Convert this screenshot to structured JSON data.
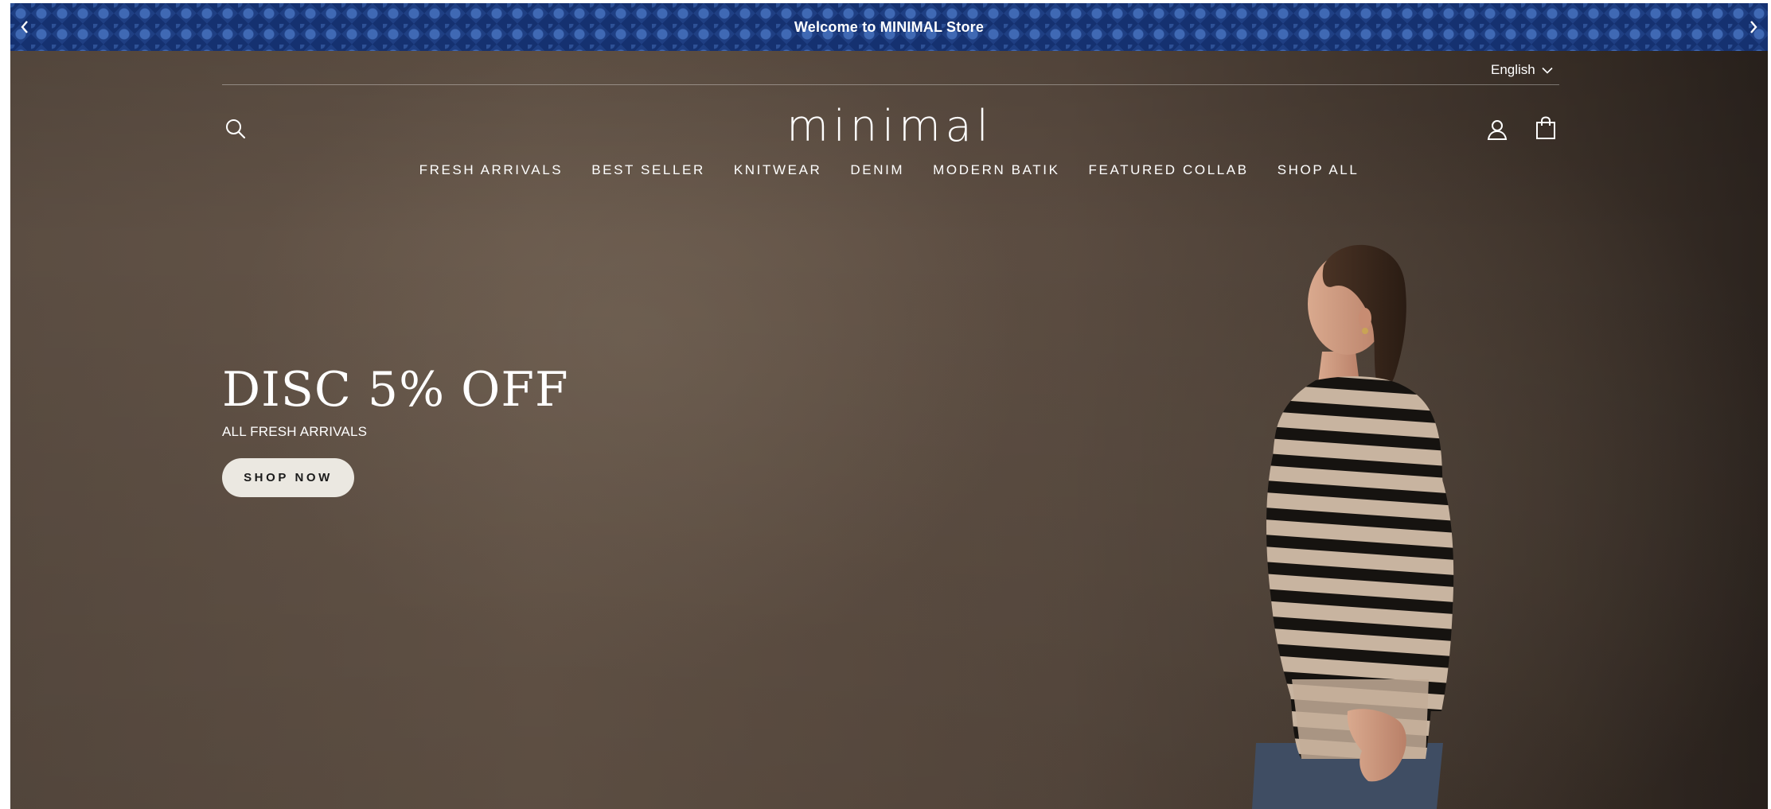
{
  "announcement": {
    "text": "Welcome to MINIMAL Store",
    "prev_icon": "chevron-left-icon",
    "next_icon": "chevron-right-icon"
  },
  "header": {
    "language": "English",
    "logo": "minimal",
    "icons": {
      "search": "search-icon",
      "account": "user-icon",
      "cart": "bag-icon",
      "language_dropdown": "chevron-down-icon"
    }
  },
  "nav": {
    "items": [
      "FRESH ARRIVALS",
      "BEST SELLER",
      "KNITWEAR",
      "DENIM",
      "MODERN BATIK",
      "FEATURED COLLAB",
      "SHOP ALL"
    ]
  },
  "hero": {
    "title": "DISC 5% OFF",
    "subtitle": "ALL FRESH ARRIVALS",
    "cta": "SHOP NOW"
  },
  "colors": {
    "announcement_bg": "#1f3f83",
    "hero_bg": "#5b4d42",
    "cta_bg": "#ebe8e1",
    "text_light": "#ffffff"
  }
}
